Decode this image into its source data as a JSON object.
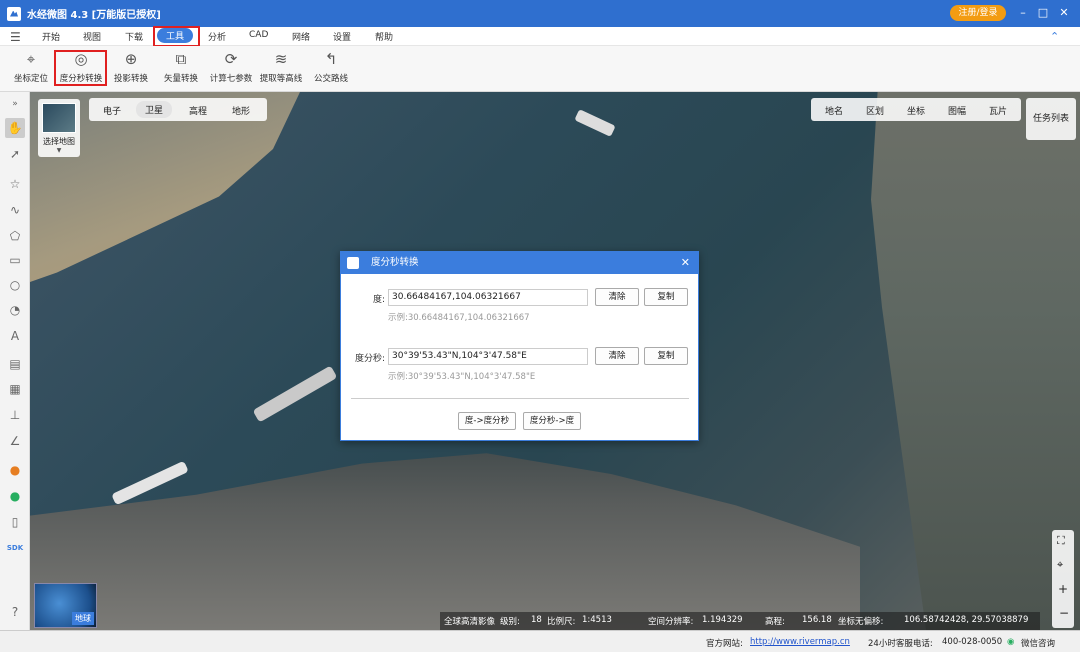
{
  "window": {
    "title": "水经微图 4.3 [万能版已授权]",
    "register_label": "注册/登录",
    "minimize": "–",
    "maximize": "□",
    "close": "✕"
  },
  "menu": {
    "items": [
      "开始",
      "视图",
      "下载",
      "工具",
      "分析",
      "CAD",
      "网络",
      "设置",
      "帮助"
    ],
    "active": "工具"
  },
  "toolbar": {
    "tools": [
      {
        "label": "坐标定位",
        "icon": "crosshair-icon"
      },
      {
        "label": "度分秒转换",
        "icon": "degree-convert-icon"
      },
      {
        "label": "投影转换",
        "icon": "projection-icon"
      },
      {
        "label": "矢量转换",
        "icon": "vector-convert-icon"
      },
      {
        "label": "计算七参数",
        "icon": "seven-param-icon"
      },
      {
        "label": "提取等高线",
        "icon": "contour-icon"
      },
      {
        "label": "公交路线",
        "icon": "bus-route-icon"
      }
    ]
  },
  "map": {
    "basemap_selector_label": "选择地图",
    "layer_tabs": [
      "电子",
      "卫星",
      "高程",
      "地形"
    ],
    "active_layer": "卫星",
    "overlay_tabs": [
      "地名",
      "区划",
      "坐标",
      "图幅",
      "瓦片"
    ],
    "task_list_label": "任务列表",
    "globe_label": "地球"
  },
  "dialog": {
    "title": "度分秒转换",
    "degree_label": "度:",
    "degree_value": "30.66484167,104.06321667",
    "degree_hint": "示例:30.66484167,104.06321667",
    "dms_label": "度分秒:",
    "dms_value": "30°39'53.43\"N,104°3'47.58\"E",
    "dms_hint": "示例:30°39'53.43\"N,104°3'47.58\"E",
    "clear_label": "清除",
    "copy_label": "复制",
    "to_dms_label": "度->度分秒",
    "to_deg_label": "度分秒->度"
  },
  "status": {
    "imagery": "全球高清影像",
    "level_label": "级别:",
    "level_value": "18",
    "scale_label": "比例尺:",
    "scale_value": "1:4513",
    "resolution_label": "空间分辨率:",
    "resolution_value": "1.194329",
    "elevation_label": "高程:",
    "elevation_value": "156.18",
    "coord_label": "坐标无偏移:",
    "coord_value": "106.58742428, 29.57038879"
  },
  "footer": {
    "website_label": "官方网站:",
    "website_url": "http://www.rivermap.cn",
    "hotline_label": "24小时客服电话:",
    "hotline_value": "400-028-0050",
    "wechat_label": "微信咨询"
  },
  "colors": {
    "accent": "#3b7ddd",
    "titlebar": "#2f6fcf",
    "register": "#f39c12",
    "highlight": "#e02020"
  }
}
